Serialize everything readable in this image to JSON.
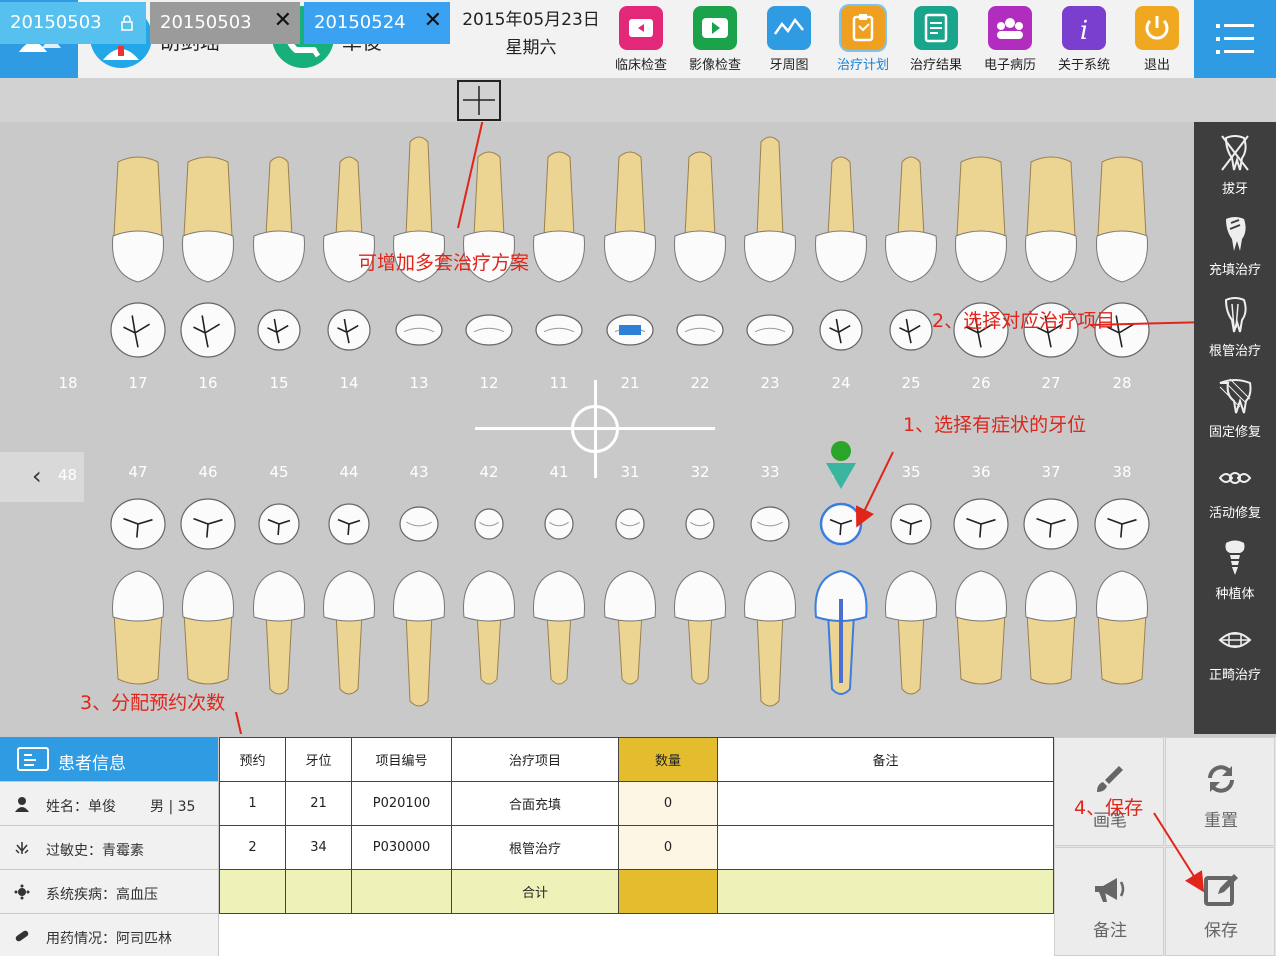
{
  "header": {
    "doctor_name": "胡剑瑶",
    "patient_name": "单俊",
    "date": "2015年05月23日",
    "weekday": "星期六",
    "tools": [
      {
        "label": "临床检查",
        "icon": "clinical-exam-icon",
        "color": "#e3287a"
      },
      {
        "label": "影像检查",
        "icon": "video-icon",
        "color": "#1aa34a"
      },
      {
        "label": "牙周图",
        "icon": "periodontal-chart-icon",
        "color": "#2f9be3"
      },
      {
        "label": "治疗计划",
        "icon": "treatment-plan-icon",
        "color": "#f0a020"
      },
      {
        "label": "治疗结果",
        "icon": "treatment-result-icon",
        "color": "#19a58c"
      },
      {
        "label": "电子病历",
        "icon": "medical-record-icon",
        "color": "#b12dbf"
      },
      {
        "label": "关于系统",
        "icon": "info-icon",
        "color": "#7b3fd0"
      },
      {
        "label": "退出",
        "icon": "power-icon",
        "color": "#f0a820"
      }
    ],
    "active_tool": "治疗计划"
  },
  "tabs": [
    {
      "label": "20150503",
      "state": "locked"
    },
    {
      "label": "20150503",
      "state": "closable"
    },
    {
      "label": "20150524",
      "state": "closable-active"
    }
  ],
  "upper_numbers": [
    "18",
    "17",
    "16",
    "15",
    "14",
    "13",
    "12",
    "11",
    "21",
    "22",
    "23",
    "24",
    "25",
    "26",
    "27",
    "28"
  ],
  "lower_numbers": [
    "48",
    "47",
    "46",
    "45",
    "44",
    "43",
    "42",
    "41",
    "31",
    "32",
    "33",
    "34",
    "35",
    "36",
    "37",
    "38"
  ],
  "selected_tooth": "34",
  "annotations": {
    "add_plan": "可增加多套治疗方案",
    "step1": "1、选择有症状的牙位",
    "step2": "2、选择对应治疗项目",
    "step3": "3、分配预约次数",
    "step4": "4、保存"
  },
  "sidebar": [
    {
      "label": "拔牙",
      "icon": "extraction-icon"
    },
    {
      "label": "充填治疗",
      "icon": "filling-icon"
    },
    {
      "label": "根管治疗",
      "icon": "root-canal-icon"
    },
    {
      "label": "固定修复",
      "icon": "fixed-restoration-icon"
    },
    {
      "label": "活动修复",
      "icon": "removable-restoration-icon"
    },
    {
      "label": "种植体",
      "icon": "implant-icon"
    },
    {
      "label": "正畸治疗",
      "icon": "orthodontic-icon"
    }
  ],
  "patient_info": {
    "title": "患者信息",
    "name_row": "姓名：单俊",
    "gender_age": "男 | 35",
    "allergy": "过敏史：青霉素",
    "disease": "系统疾病：高血压",
    "medication": "用药情况：阿司匹林"
  },
  "table": {
    "headers": [
      "预约",
      "牙位",
      "项目编号",
      "治疗项目",
      "数量",
      "备注"
    ],
    "rows": [
      [
        "1",
        "21",
        "P020100",
        "合面充填",
        "0",
        ""
      ],
      [
        "2",
        "34",
        "P030000",
        "根管治疗",
        "0",
        ""
      ]
    ],
    "total_label": "合计"
  },
  "actions": {
    "pen": "画笔",
    "reset": "重置",
    "note": "备注",
    "save": "保存"
  }
}
